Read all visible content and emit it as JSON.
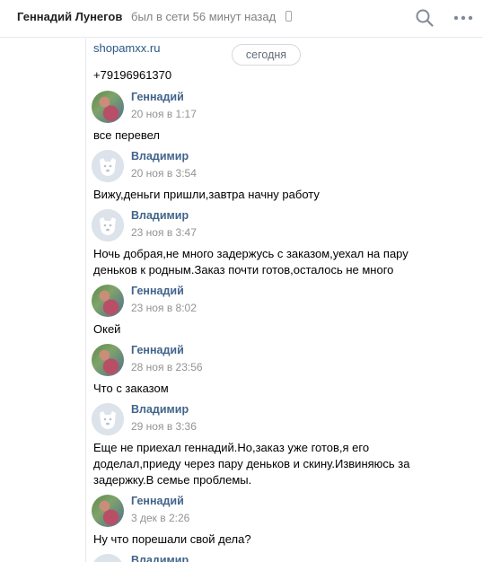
{
  "header": {
    "contact_name": "Геннадий Лунегов",
    "status": "был в сети 56 минут назад"
  },
  "day_separator": "сегодня",
  "top": {
    "link_text": "shopamxx.ru",
    "phone_text": "+79196961370"
  },
  "messages": [
    {
      "author": "Геннадий",
      "avatar": "photo",
      "date": "20 ноя в 1:17",
      "text": "все перевел"
    },
    {
      "author": "Владимир",
      "avatar": "dog",
      "date": "20 ноя в 3:54",
      "text": "Вижу,деньги пришли,завтра начну работу"
    },
    {
      "author": "Владимир",
      "avatar": "dog",
      "date": "23 ноя в 3:47",
      "text_lines": [
        "Ночь добрая,не много задержусь с заказом,уехал на пару",
        "деньков к родным.Заказ почти готов,осталось не много"
      ]
    },
    {
      "author": "Геннадий",
      "avatar": "photo",
      "date": "23 ноя в 8:02",
      "text": "Окей"
    },
    {
      "author": "Геннадий",
      "avatar": "photo",
      "date": "28 ноя в 23:56",
      "text": "Что с заказом"
    },
    {
      "author": "Владимир",
      "avatar": "dog",
      "date": "29 ноя в 3:36",
      "text_lines": [
        "Еще не приехал геннадий.Но,заказ уже готов,я его",
        "доделал,приеду через пару деньков и скину.Извиняюсь за",
        "задержку.В семье проблемы."
      ]
    },
    {
      "author": "Геннадий",
      "avatar": "photo",
      "date": "3 дек в 2:26",
      "text": "Ну что порешали свой дела?"
    },
    {
      "author": "Владимир",
      "avatar": "dog"
    }
  ],
  "icons": {
    "phone": "mobile-phone-icon",
    "search": "search-icon",
    "more": "more-dots-icon",
    "avatar_default": "dog-avatar-icon"
  },
  "colors": {
    "link": "#2a5885",
    "author": "#42648b",
    "date": "#939393",
    "status": "#828282"
  }
}
